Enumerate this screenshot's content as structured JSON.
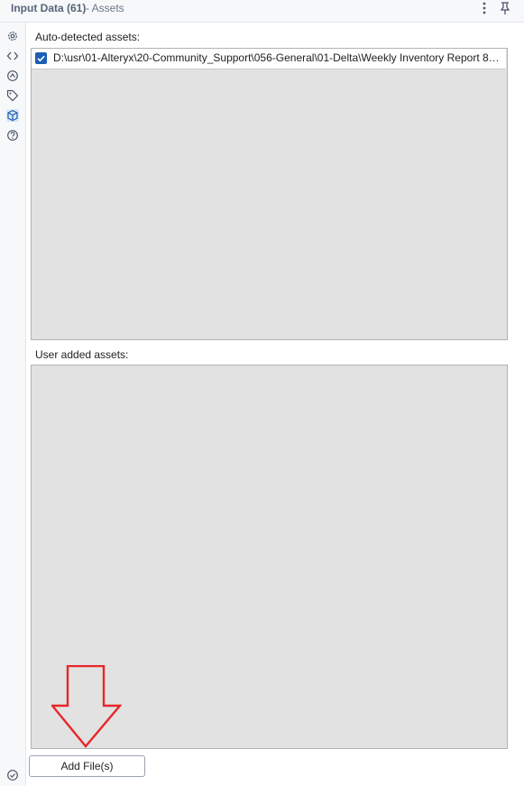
{
  "header": {
    "title": "Input Data (61)",
    "subtitle": "- Assets",
    "menu_icon": "kebab-menu-icon",
    "pin_icon": "pin-icon"
  },
  "rail": {
    "icons": [
      "gear-icon",
      "code-icon",
      "annotation-icon",
      "tag-icon",
      "assets-icon",
      "help-icon"
    ],
    "active": "assets-icon",
    "bottom_icon": "check-circle-icon"
  },
  "auto_detected": {
    "label": "Auto-detected assets:",
    "items": [
      {
        "checked": true,
        "path": "D:\\usr\\01-Alteryx\\20-Community_Support\\056-General\\01-Delta\\Weekly Inventory Report 8-16-23 - Co..."
      }
    ]
  },
  "user_added": {
    "label": "User added assets:",
    "items": []
  },
  "add_button": {
    "label": "Add File(s)"
  },
  "colors": {
    "panel_bg": "#e2e2e2",
    "checkbox": "#1a5fb4",
    "annotation_arrow": "#e8262a",
    "rail_icon": "#4a5668"
  }
}
